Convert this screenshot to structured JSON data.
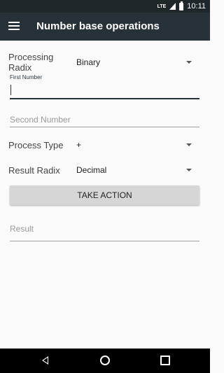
{
  "status_bar": {
    "network": "LTE",
    "time": "10:11"
  },
  "app_bar": {
    "title": "Number base operations",
    "menu_icon": "hamburger-menu-icon"
  },
  "form": {
    "processing_radix": {
      "label": "Processing Radix",
      "value": "Binary"
    },
    "first_number": {
      "floating_label": "First Number",
      "value": ""
    },
    "second_number": {
      "placeholder": "Second Number",
      "value": ""
    },
    "process_type": {
      "label": "Process Type",
      "value": "+"
    },
    "result_radix": {
      "label": "Result Radix",
      "value": "Decimal"
    },
    "action_button": "TAKE ACTION",
    "result": {
      "placeholder": "Result",
      "value": ""
    }
  },
  "nav_bar": {
    "back_icon": "back-triangle-icon",
    "home_icon": "home-circle-icon",
    "recents_icon": "recents-square-icon"
  },
  "colors": {
    "app_bar": "#263238",
    "status_bar": "#1e272a",
    "accent": "#263238",
    "button": "#d6d6d6"
  }
}
